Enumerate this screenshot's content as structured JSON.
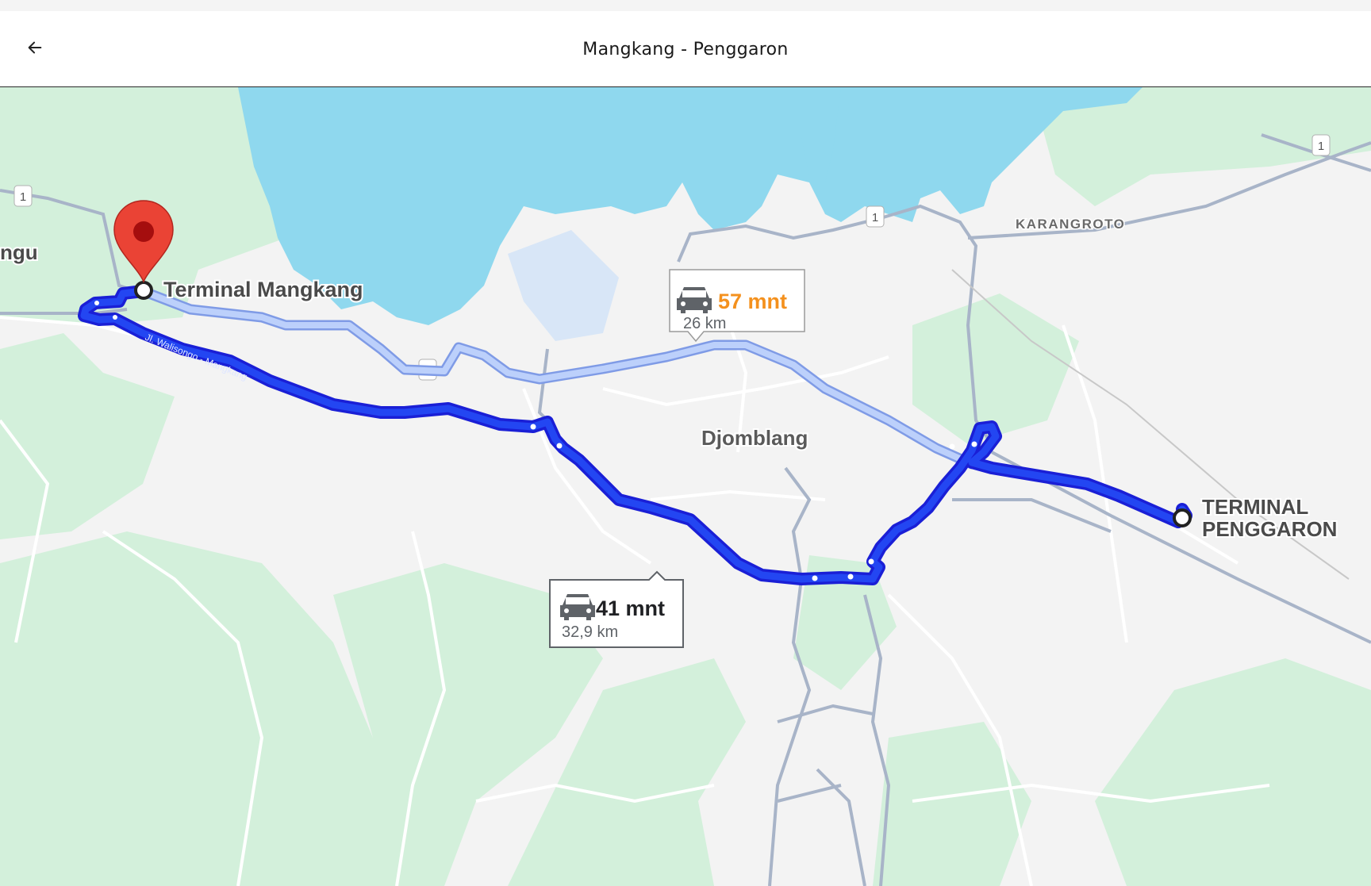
{
  "header": {
    "title": "Mangkang - Penggaron",
    "back_icon": "arrow-left-icon"
  },
  "map": {
    "labels": {
      "start": "Terminal Mangkang",
      "district": "Djomblang",
      "area_ne": "KARANGROTO",
      "edge_left": "ngu",
      "end_line1": "TERMINAL",
      "end_line2": "PENGGARON",
      "street": "Jl. Walisongo - Mangkang"
    },
    "highway_shield": "1",
    "routes": [
      {
        "duration": "57 mnt",
        "distance": "26 km",
        "selected": false,
        "duration_color": "#f4911e"
      },
      {
        "duration": "41 mnt",
        "distance": "32,9 km",
        "selected": true,
        "duration_color": "#202124"
      }
    ],
    "icons": {
      "origin": "red-pin-icon",
      "destination": "circle-marker-icon",
      "vehicle": "car-icon"
    },
    "colors": {
      "water": "#8fd8ee",
      "park": "#d4f0dc",
      "route_selected": "#1a35e8",
      "route_alt": "#a9bdf5"
    }
  }
}
